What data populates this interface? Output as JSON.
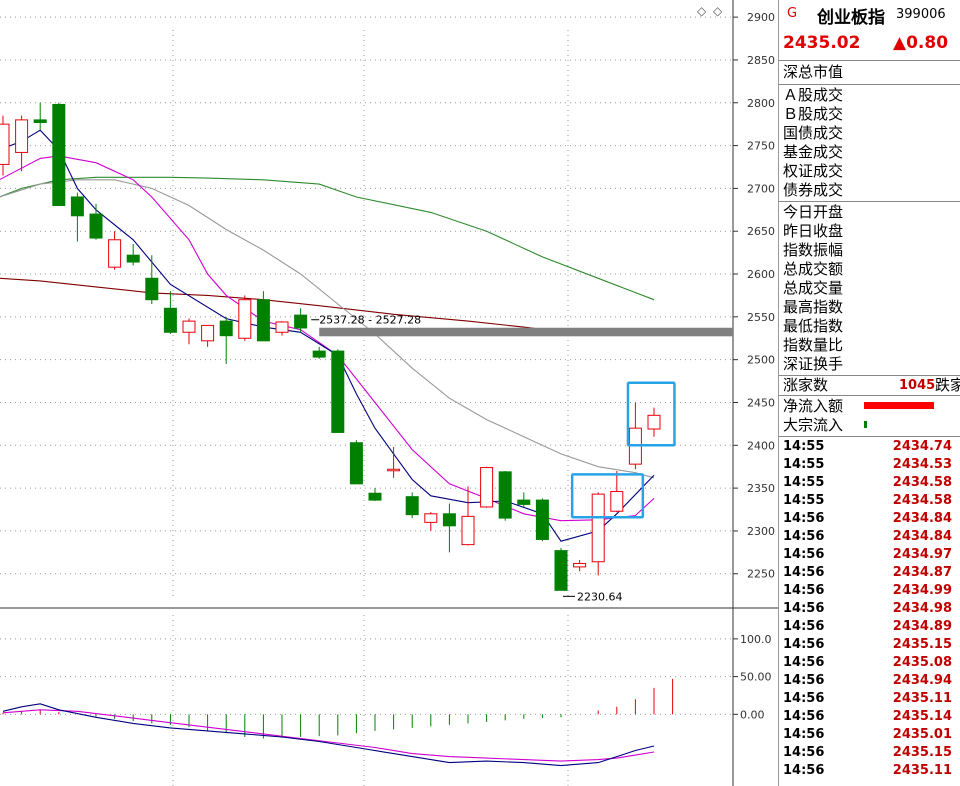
{
  "colors": {
    "up": "#e8000b",
    "down": "#008000",
    "ma5": "#000080",
    "ma10": "#d000d0",
    "ma20": "#999999",
    "ma60": "#2e8b2e",
    "ma120": "#800000",
    "highlight": "#29a3e8",
    "band": "#808080"
  },
  "chart_toolbar": {
    "diamond_icon": "◇",
    "expand_icon": "◇"
  },
  "chart_data": {
    "type": "candlestick",
    "ylim": [
      2210,
      2920
    ],
    "yticks": [
      "2900",
      "2850",
      "2800",
      "2750",
      "2700",
      "2650",
      "2600",
      "2550",
      "2500",
      "2450",
      "2400",
      "2350",
      "2300",
      "2250"
    ],
    "candles": [
      {
        "o": 2728,
        "h": 2785,
        "l": 2715,
        "c": 2775
      },
      {
        "o": 2742,
        "h": 2785,
        "l": 2720,
        "c": 2780
      },
      {
        "o": 2780,
        "h": 2800,
        "l": 2768,
        "c": 2777
      },
      {
        "o": 2798,
        "h": 2800,
        "l": 2680,
        "c": 2680
      },
      {
        "o": 2690,
        "h": 2695,
        "l": 2638,
        "c": 2668
      },
      {
        "o": 2670,
        "h": 2682,
        "l": 2640,
        "c": 2642
      },
      {
        "o": 2608,
        "h": 2650,
        "l": 2605,
        "c": 2640
      },
      {
        "o": 2622,
        "h": 2635,
        "l": 2610,
        "c": 2614
      },
      {
        "o": 2595,
        "h": 2622,
        "l": 2565,
        "c": 2570
      },
      {
        "o": 2560,
        "h": 2580,
        "l": 2530,
        "c": 2532
      },
      {
        "o": 2532,
        "h": 2548,
        "l": 2518,
        "c": 2545
      },
      {
        "o": 2522,
        "h": 2540,
        "l": 2515,
        "c": 2540
      },
      {
        "o": 2545,
        "h": 2550,
        "l": 2495,
        "c": 2528
      },
      {
        "o": 2525,
        "h": 2575,
        "l": 2522,
        "c": 2570
      },
      {
        "o": 2570,
        "h": 2580,
        "l": 2522,
        "c": 2522
      },
      {
        "o": 2532,
        "h": 2545,
        "l": 2528,
        "c": 2544
      },
      {
        "o": 2552,
        "h": 2560,
        "l": 2532,
        "c": 2537
      },
      {
        "o": 2510,
        "h": 2515,
        "l": 2501,
        "c": 2503
      },
      {
        "o": 2510,
        "h": 2512,
        "l": 2415,
        "c": 2415
      },
      {
        "o": 2403,
        "h": 2406,
        "l": 2355,
        "c": 2355
      },
      {
        "o": 2344,
        "h": 2350,
        "l": 2335,
        "c": 2336
      },
      {
        "o": 2372,
        "h": 2398,
        "l": 2362,
        "c": 2372
      },
      {
        "o": 2340,
        "h": 2345,
        "l": 2315,
        "c": 2319
      },
      {
        "o": 2310,
        "h": 2322,
        "l": 2300,
        "c": 2320
      },
      {
        "o": 2320,
        "h": 2332,
        "l": 2275,
        "c": 2306
      },
      {
        "o": 2284,
        "h": 2352,
        "l": 2283,
        "c": 2317
      },
      {
        "o": 2328,
        "h": 2375,
        "l": 2327,
        "c": 2374
      },
      {
        "o": 2369,
        "h": 2370,
        "l": 2312,
        "c": 2315
      },
      {
        "o": 2336,
        "h": 2345,
        "l": 2328,
        "c": 2331
      },
      {
        "o": 2336,
        "h": 2338,
        "l": 2288,
        "c": 2290
      },
      {
        "o": 2277,
        "h": 2280,
        "l": 2230.64,
        "c": 2230.64
      },
      {
        "o": 2258,
        "h": 2266,
        "l": 2253,
        "c": 2262
      },
      {
        "o": 2264,
        "h": 2345,
        "l": 2248,
        "c": 2343
      },
      {
        "o": 2323,
        "h": 2370,
        "l": 2322,
        "c": 2346
      },
      {
        "o": 2378,
        "h": 2450,
        "l": 2372,
        "c": 2420
      },
      {
        "o": 2419,
        "h": 2444,
        "l": 2410,
        "c": 2435
      }
    ],
    "ma5": [
      [
        0,
        2745
      ],
      [
        1,
        2755
      ],
      [
        2,
        2768
      ],
      [
        3,
        2745
      ],
      [
        4,
        2700
      ],
      [
        5,
        2675
      ],
      [
        7,
        2640
      ],
      [
        9,
        2588
      ],
      [
        12,
        2548
      ],
      [
        14,
        2538
      ],
      [
        16,
        2532
      ],
      [
        18,
        2505
      ],
      [
        19,
        2460
      ],
      [
        20,
        2420
      ],
      [
        21,
        2390
      ],
      [
        22,
        2360
      ],
      [
        23,
        2341
      ],
      [
        25,
        2333
      ],
      [
        27,
        2335
      ],
      [
        29,
        2320
      ],
      [
        30,
        2288
      ],
      [
        32,
        2300
      ],
      [
        33,
        2320
      ],
      [
        35,
        2365
      ]
    ],
    "ma10": [
      [
        0,
        2710
      ],
      [
        2,
        2735
      ],
      [
        3,
        2738
      ],
      [
        5,
        2730
      ],
      [
        7,
        2710
      ],
      [
        8,
        2690
      ],
      [
        10,
        2640
      ],
      [
        11,
        2600
      ],
      [
        12,
        2575
      ],
      [
        14,
        2545
      ],
      [
        16,
        2535
      ],
      [
        18,
        2505
      ],
      [
        20,
        2450
      ],
      [
        22,
        2395
      ],
      [
        24,
        2355
      ],
      [
        26,
        2338
      ],
      [
        28,
        2320
      ],
      [
        30,
        2312
      ],
      [
        32,
        2313
      ],
      [
        34,
        2318
      ],
      [
        35,
        2338
      ]
    ],
    "ma20": [
      [
        0,
        2690
      ],
      [
        2,
        2705
      ],
      [
        4,
        2710
      ],
      [
        6,
        2710
      ],
      [
        8,
        2700
      ],
      [
        10,
        2680
      ],
      [
        12,
        2652
      ],
      [
        14,
        2628
      ],
      [
        16,
        2600
      ],
      [
        18,
        2565
      ],
      [
        20,
        2530
      ],
      [
        22,
        2490
      ],
      [
        24,
        2455
      ],
      [
        26,
        2430
      ],
      [
        28,
        2410
      ],
      [
        30,
        2390
      ],
      [
        32,
        2375
      ],
      [
        34,
        2368
      ],
      [
        35,
        2362
      ]
    ],
    "ma60": [
      [
        0,
        2690
      ],
      [
        1,
        2700
      ],
      [
        3,
        2710
      ],
      [
        5,
        2713
      ],
      [
        9,
        2713
      ],
      [
        11,
        2712
      ],
      [
        14,
        2710
      ],
      [
        17,
        2705
      ],
      [
        19,
        2690
      ],
      [
        23,
        2672
      ],
      [
        26,
        2650
      ],
      [
        29,
        2620
      ],
      [
        32,
        2595
      ],
      [
        35,
        2570
      ]
    ],
    "ma120": [
      [
        0,
        2595
      ],
      [
        2,
        2592
      ],
      [
        5,
        2585
      ],
      [
        8,
        2578
      ],
      [
        11,
        2575
      ],
      [
        14,
        2570
      ],
      [
        17,
        2563
      ],
      [
        21,
        2553
      ],
      [
        25,
        2545
      ],
      [
        28,
        2538
      ],
      [
        31,
        2530
      ],
      [
        33,
        2530
      ],
      [
        35,
        2530
      ]
    ],
    "band": {
      "y1": 2537.28,
      "y2": 2527.28,
      "from": 17,
      "label": "2537.28 - 2527.28"
    },
    "min_label": "2230.64",
    "highlight_boxes": [
      {
        "from": 30.6,
        "to": 34.4,
        "lo": 2316,
        "hi": 2366
      },
      {
        "from": 33.6,
        "to": 36.1,
        "lo": 2400,
        "hi": 2473
      }
    ]
  },
  "macd": {
    "yticks": [
      "100.0",
      "50.00",
      "0.00"
    ],
    "ylim": [
      -95,
      125
    ],
    "hist": [
      2,
      4,
      6,
      3,
      0,
      -3,
      -6,
      -9,
      -12,
      -14,
      -17,
      -22,
      -25,
      -30,
      -32,
      -31,
      -30,
      -29,
      -28,
      -25,
      -22,
      -20,
      -18,
      -16,
      -14,
      -12,
      -10,
      -8,
      -6,
      -5,
      -4,
      0,
      5,
      10,
      20,
      35,
      47
    ],
    "dif": [
      [
        0,
        4
      ],
      [
        1,
        10
      ],
      [
        2,
        14
      ],
      [
        3,
        6
      ],
      [
        5,
        -4
      ],
      [
        7,
        -12
      ],
      [
        9,
        -18
      ],
      [
        11,
        -22
      ],
      [
        13,
        -26
      ],
      [
        15,
        -30
      ],
      [
        17,
        -36
      ],
      [
        19,
        -44
      ],
      [
        21,
        -52
      ],
      [
        23,
        -60
      ],
      [
        24,
        -64
      ],
      [
        26,
        -62
      ],
      [
        28,
        -64
      ],
      [
        30,
        -68
      ],
      [
        32,
        -64
      ],
      [
        33,
        -56
      ],
      [
        34,
        -48
      ],
      [
        35,
        -42
      ]
    ],
    "dea": [
      [
        0,
        2
      ],
      [
        2,
        6
      ],
      [
        4,
        4
      ],
      [
        6,
        -2
      ],
      [
        8,
        -8
      ],
      [
        10,
        -14
      ],
      [
        12,
        -20
      ],
      [
        14,
        -26
      ],
      [
        16,
        -32
      ],
      [
        18,
        -38
      ],
      [
        20,
        -44
      ],
      [
        22,
        -52
      ],
      [
        24,
        -56
      ],
      [
        26,
        -58
      ],
      [
        28,
        -60
      ],
      [
        30,
        -62
      ],
      [
        32,
        -60
      ],
      [
        33,
        -58
      ],
      [
        34,
        -54
      ],
      [
        35,
        -50
      ]
    ]
  },
  "panel": {
    "g": "G",
    "name": "创业板指",
    "code": "399006",
    "price": "2435.02",
    "change": "▲0.80",
    "sec1": [
      "深总市值"
    ],
    "sec2": [
      "Ａ股成交",
      "Ｂ股成交",
      "国债成交",
      "基金成交",
      "权证成交",
      "债券成交"
    ],
    "sec3": [
      "今日开盘",
      "昨日收盘",
      "指数振幅",
      "总成交额",
      "总成交量",
      "最高指数",
      "最低指数",
      "指数量比",
      "深证换手"
    ],
    "updown": {
      "label": "涨家数",
      "value": "1045",
      "next": "跌家"
    },
    "flows": [
      {
        "label": "净流入额",
        "bar": 0.78
      },
      {
        "label": "大宗流入",
        "bar": 0.03
      }
    ],
    "ticks": [
      {
        "t": "14:55",
        "v": "2434.74"
      },
      {
        "t": "14:55",
        "v": "2434.53"
      },
      {
        "t": "14:55",
        "v": "2434.58"
      },
      {
        "t": "14:55",
        "v": "2434.58"
      },
      {
        "t": "14:56",
        "v": "2434.84"
      },
      {
        "t": "14:56",
        "v": "2434.84"
      },
      {
        "t": "14:56",
        "v": "2434.97"
      },
      {
        "t": "14:56",
        "v": "2434.87"
      },
      {
        "t": "14:56",
        "v": "2434.99"
      },
      {
        "t": "14:56",
        "v": "2434.98"
      },
      {
        "t": "14:56",
        "v": "2434.89"
      },
      {
        "t": "14:56",
        "v": "2435.15"
      },
      {
        "t": "14:56",
        "v": "2435.08"
      },
      {
        "t": "14:56",
        "v": "2434.94"
      },
      {
        "t": "14:56",
        "v": "2435.11"
      },
      {
        "t": "14:56",
        "v": "2435.14"
      },
      {
        "t": "14:56",
        "v": "2435.01"
      },
      {
        "t": "14:56",
        "v": "2435.15"
      },
      {
        "t": "14:56",
        "v": "2435.11"
      }
    ]
  }
}
